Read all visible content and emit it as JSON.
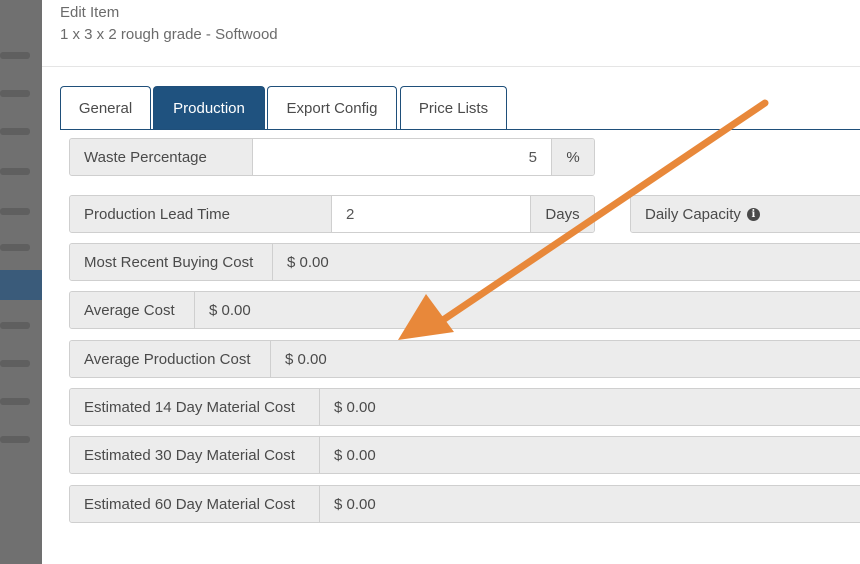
{
  "modal": {
    "title": "Edit Item",
    "subtitle": "1 x 3 x 2 rough grade - Softwood"
  },
  "tabs": [
    {
      "label": "General",
      "active": false
    },
    {
      "label": "Production",
      "active": true
    },
    {
      "label": "Export Config",
      "active": false
    },
    {
      "label": "Price Lists",
      "active": false
    }
  ],
  "fields": {
    "waste_percentage": {
      "label": "Waste Percentage",
      "value": "5",
      "unit": "%"
    },
    "production_lead_time": {
      "label": "Production Lead Time",
      "value": "2",
      "unit": "Days"
    },
    "daily_capacity": {
      "label": "Daily Capacity",
      "icon": "info-icon"
    },
    "most_recent_buying_cost": {
      "label": "Most Recent Buying Cost",
      "value": "$ 0.00"
    },
    "average_cost": {
      "label": "Average Cost",
      "value": "$ 0.00"
    },
    "average_production_cost": {
      "label": "Average Production Cost",
      "value": "$ 0.00"
    },
    "est_14_day": {
      "label": "Estimated 14 Day Material Cost",
      "value": "$ 0.00"
    },
    "est_30_day": {
      "label": "Estimated 30 Day Material Cost",
      "value": "$ 0.00"
    },
    "est_60_day": {
      "label": "Estimated 60 Day Material Cost",
      "value": "$ 0.00"
    }
  },
  "annotation": {
    "type": "arrow",
    "color": "#e8883a"
  },
  "colors": {
    "tab_active": "#1f527f",
    "addon_bg": "#ececec"
  }
}
